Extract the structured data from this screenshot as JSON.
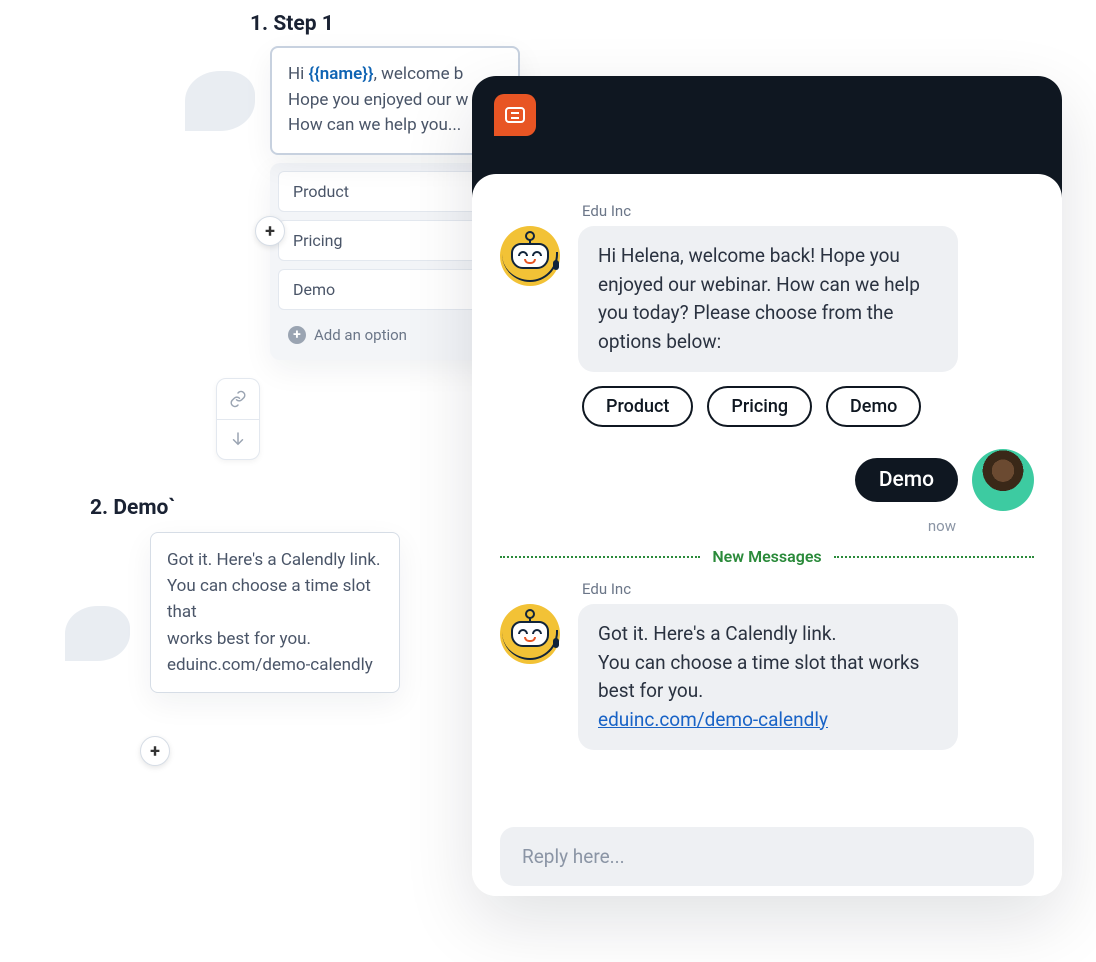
{
  "flow": {
    "step1_label": "1. Step 1",
    "step1_msg_prefix": "Hi ",
    "step1_msg_var": "{{name}}",
    "step1_msg_line1_suffix": ", welcome b",
    "step1_msg_line2": "Hope you enjoyed our w",
    "step1_msg_line3": "How can we help you...",
    "options": [
      "Product",
      "Pricing",
      "Demo"
    ],
    "add_option_label": "Add an option",
    "step2_label": "2. Demo`",
    "step2_msg_line1": "Got it. Here's a Calendly link.",
    "step2_msg_line2": "You can choose a time slot that",
    "step2_msg_line3": "works best for you.",
    "step2_msg_link": "eduinc.com/demo-calendly"
  },
  "chat": {
    "sender": "Edu Inc",
    "bot_msg_1": "Hi Helena, welcome back! Hope you enjoyed our webinar. How can we help you today? Please choose from the options below:",
    "chips": [
      "Product",
      "Pricing",
      "Demo"
    ],
    "user_msg": "Demo",
    "user_timestamp": "now",
    "new_messages_label": "New Messages",
    "bot_msg_2_line1": "Got it. Here's a Calendly link.",
    "bot_msg_2_line2": "You can choose a time slot that works best for you.",
    "bot_msg_2_link": "eduinc.com/demo-calendly",
    "reply_placeholder": "Reply here..."
  }
}
